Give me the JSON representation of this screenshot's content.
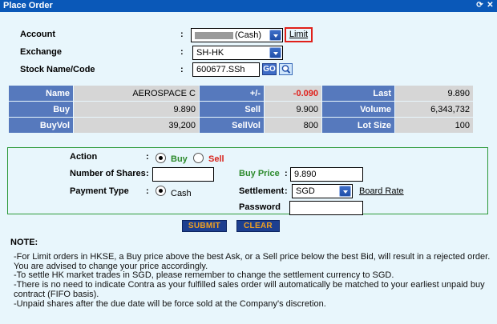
{
  "window": {
    "title": "Place Order"
  },
  "form": {
    "account_label": "Account",
    "account_value": "(Cash)",
    "limit_link": "Limit",
    "exchange_label": "Exchange",
    "exchange_value": "SH-HK",
    "stock_label": "Stock Name/Code",
    "stock_value": "600677.SSh",
    "go_label": "GO",
    "colon": ":"
  },
  "quote": {
    "rows": [
      [
        {
          "h": "Name"
        },
        {
          "v": "AEROSPACE C"
        },
        {
          "h": "+/-"
        },
        {
          "v": "-0.090",
          "neg": true
        },
        {
          "h": "Last"
        },
        {
          "v": "9.890"
        }
      ],
      [
        {
          "h": "Buy"
        },
        {
          "v": "9.890"
        },
        {
          "h": "Sell"
        },
        {
          "v": "9.900"
        },
        {
          "h": "Volume"
        },
        {
          "v": "6,343,732"
        }
      ],
      [
        {
          "h": "BuyVol"
        },
        {
          "v": "39,200"
        },
        {
          "h": "SellVol"
        },
        {
          "v": "800"
        },
        {
          "h": "Lot Size"
        },
        {
          "v": "100"
        }
      ]
    ]
  },
  "order": {
    "action_label": "Action",
    "buy_label": "Buy",
    "sell_label": "Sell",
    "shares_label": "Number of Shares",
    "shares_value": "",
    "payment_label": "Payment Type",
    "cash_label": "Cash",
    "buy_price_label": "Buy Price",
    "buy_price_value": "9.890",
    "settlement_label": "Settlement",
    "settlement_value": "SGD",
    "board_rate_link": "Board Rate",
    "password_label": "Password",
    "password_value": ""
  },
  "buttons": {
    "submit": "SUBMIT",
    "clear": "CLEAR"
  },
  "note": {
    "title": "NOTE:",
    "lines": [
      "-For Limit orders in HKSE, a Buy price above the best Ask, or a Sell price below the best Bid, will result in a rejected order. You are advised to change your price accordingly.",
      "-To settle HK market trades in SGD, please remember to change the settlement currency to SGD.",
      "-There is no need to indicate Contra as your fulfilled sales order will automatically be matched to your earliest unpaid buy contract (FIFO basis).",
      "-Unpaid shares after the due date will be force sold at the Company's discretion."
    ]
  },
  "colors": {
    "titlebar": "#0a58b8",
    "header_cell": "#5679bd",
    "value_cell": "#d6d6d6",
    "negative": "#e0201a",
    "accent_green": "#2c8a2c",
    "button_bg": "#1d3f8f",
    "button_text": "#f0a020"
  }
}
